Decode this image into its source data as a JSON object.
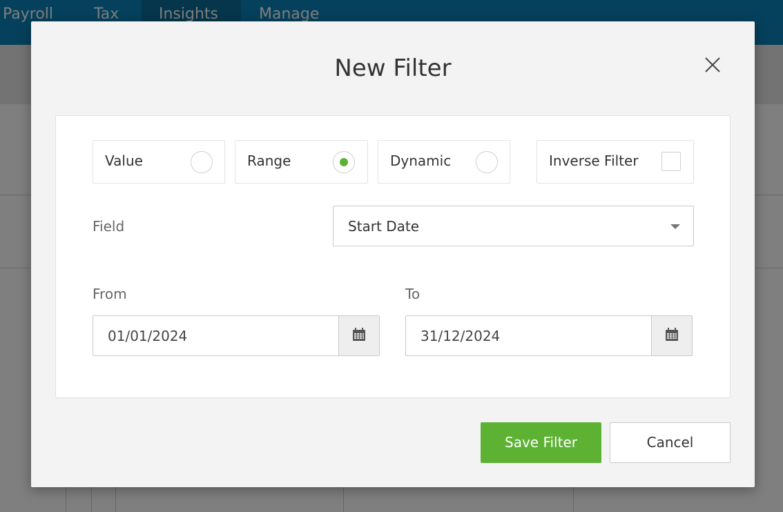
{
  "background": {
    "nav_items": [
      "Payroll",
      "Tax",
      "Insights",
      "Manage"
    ],
    "active_nav": "Insights"
  },
  "modal": {
    "title": "New Filter",
    "filter_types": [
      {
        "label": "Value",
        "selected": false
      },
      {
        "label": "Range",
        "selected": true
      },
      {
        "label": "Dynamic",
        "selected": false
      }
    ],
    "inverse_filter": {
      "label": "Inverse Filter",
      "checked": false
    },
    "field": {
      "label": "Field",
      "value": "Start Date"
    },
    "from": {
      "label": "From",
      "value": "01/01/2024"
    },
    "to": {
      "label": "To",
      "value": "31/12/2024"
    },
    "save_label": "Save Filter",
    "cancel_label": "Cancel"
  },
  "colors": {
    "accent_green": "#5db234",
    "nav_blue": "#0a83b8"
  },
  "icons": {
    "close": "close-icon",
    "calendar": "calendar-icon",
    "dropdown": "chevron-down-icon"
  }
}
